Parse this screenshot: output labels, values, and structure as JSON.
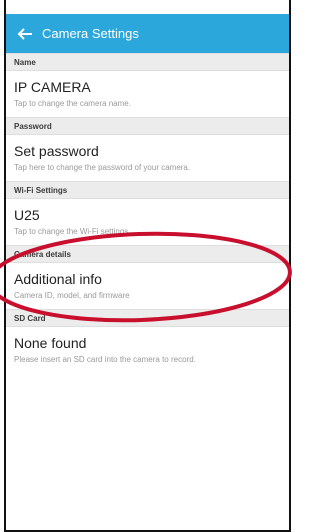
{
  "app_bar": {
    "title": "Camera Settings",
    "back_icon": "arrow-left-icon"
  },
  "sections": [
    {
      "header": "Name",
      "item": {
        "title": "IP CAMERA",
        "subtitle": "Tap to change the camera name."
      }
    },
    {
      "header": "Password",
      "item": {
        "title": "Set password",
        "subtitle": "Tap here to change the password of your camera."
      }
    },
    {
      "header": "Wi-Fi Settings",
      "item": {
        "title": "U25",
        "subtitle": "Tap to change the Wi-Fi settings."
      }
    },
    {
      "header": "Camera details",
      "item": {
        "title": "Additional info",
        "subtitle": "Camera ID, model, and firmware"
      }
    },
    {
      "header": "SD Card",
      "item": {
        "title": "None found",
        "subtitle": "Please insert an SD card into the camera to record."
      }
    }
  ],
  "colors": {
    "app_bar": "#2ca7dc",
    "highlight": "#c8102e",
    "section_bg": "#ececec"
  }
}
